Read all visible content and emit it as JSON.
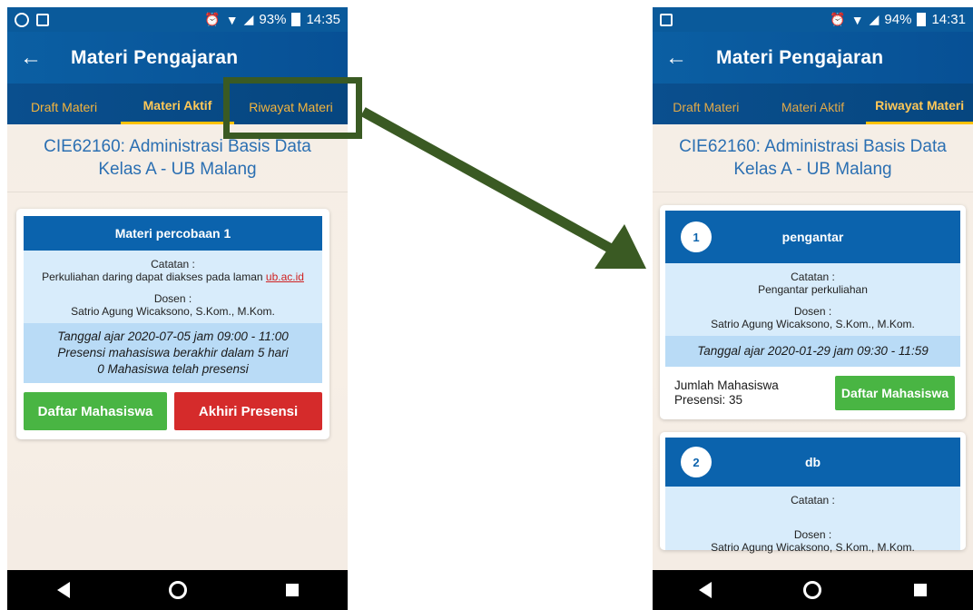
{
  "left": {
    "status": {
      "percent": "93%",
      "time": "14:35"
    },
    "appbar": {
      "title": "Materi Pengajaran"
    },
    "tabs": [
      "Draft Materi",
      "Materi Aktif",
      "Riwayat Materi"
    ],
    "course_title": "CIE62160: Administrasi Basis Data Kelas A - UB Malang",
    "card": {
      "title": "Materi percobaan 1",
      "catatan_label": "Catatan :",
      "catatan_text": "Perkuliahan daring dapat diakses pada laman",
      "catatan_link": "ub.ac.id",
      "dosen_label": "Dosen :",
      "dosen_name": "Satrio Agung Wicaksono, S.Kom., M.Kom.",
      "date_line": "Tanggal ajar 2020-07-05 jam 09:00 - 11:00",
      "presensi_line": "Presensi mahasiswa berakhir dalam 5 hari",
      "count_line": "0 Mahasiswa telah presensi",
      "btn_daftar": "Daftar Mahasiswa",
      "btn_akhiri": "Akhiri Presensi"
    }
  },
  "right": {
    "status": {
      "percent": "94%",
      "time": "14:31"
    },
    "appbar": {
      "title": "Materi Pengajaran"
    },
    "tabs": [
      "Draft Materi",
      "Materi Aktif",
      "Riwayat Materi"
    ],
    "course_title": "CIE62160: Administrasi Basis Data Kelas A - UB Malang",
    "cards": [
      {
        "number": "1",
        "title": "pengantar",
        "catatan_label": "Catatan :",
        "catatan_text": "Pengantar perkuliahan",
        "dosen_label": "Dosen :",
        "dosen_name": "Satrio Agung Wicaksono, S.Kom., M.Kom.",
        "date_line": "Tanggal ajar 2020-01-29 jam 09:30 - 11:59",
        "jumlah_label": "Jumlah Mahasiswa",
        "presensi_label": "Presensi: 35",
        "btn_daftar": "Daftar Mahasiswa"
      },
      {
        "number": "2",
        "title": "db",
        "catatan_label": "Catatan :",
        "dosen_label": "Dosen :",
        "dosen_name": "Satrio Agung Wicaksono, S.Kom., M.Kom."
      }
    ]
  },
  "colors": {
    "primary": "#0b63ad",
    "accent": "#ffc107",
    "green": "#49b543",
    "red": "#d52b2b",
    "annotation": "#3a5a23"
  },
  "icons": [
    "whatsapp-icon",
    "image-icon",
    "alarm-icon",
    "wifi-icon",
    "signal-icon",
    "battery-icon",
    "back-arrow-icon",
    "nav-back-icon",
    "nav-home-icon",
    "nav-recent-icon"
  ]
}
